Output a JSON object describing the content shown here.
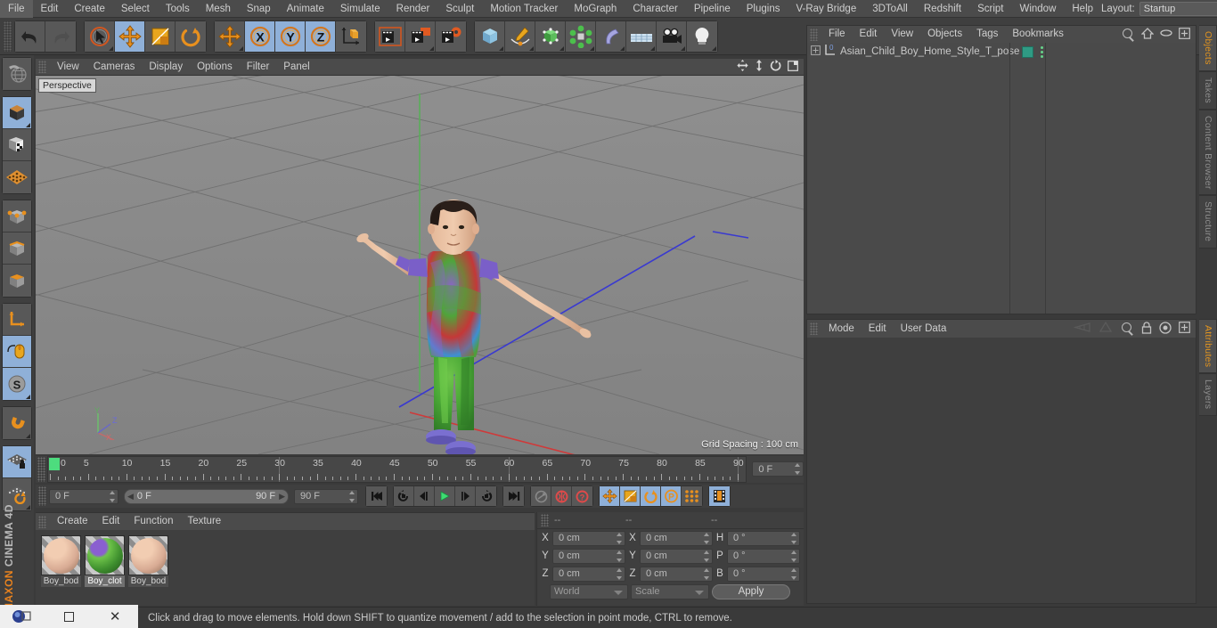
{
  "menubar": {
    "items": [
      "File",
      "Edit",
      "Create",
      "Select",
      "Tools",
      "Mesh",
      "Snap",
      "Animate",
      "Simulate",
      "Render",
      "Sculpt",
      "Motion Tracker",
      "MoGraph",
      "Character",
      "Pipeline",
      "Plugins",
      "V-Ray Bridge",
      "3DToAll",
      "Redshift",
      "Script",
      "Window",
      "Help"
    ],
    "layout_label": "Layout:",
    "layout_value": "Startup",
    "search_icon": "search-icon"
  },
  "toolbar": {
    "groups": [
      {
        "name": "undo-redo",
        "buttons": [
          {
            "icon": "undo-icon",
            "label": "Undo",
            "selected": false
          },
          {
            "icon": "redo-icon",
            "label": "Redo",
            "selected": false
          }
        ]
      },
      {
        "name": "transform-tools",
        "buttons": [
          {
            "icon": "live-selection-icon",
            "label": "Live Selection",
            "selected": false
          },
          {
            "icon": "move-icon",
            "label": "Move",
            "selected": true
          },
          {
            "icon": "scale-icon",
            "label": "Scale",
            "selected": false
          },
          {
            "icon": "rotate-icon",
            "label": "Rotate",
            "selected": false
          }
        ]
      },
      {
        "name": "axis-lock",
        "buttons": [
          {
            "icon": "move-icon",
            "label": "Move",
            "selected": false
          },
          {
            "icon": "x-axis-icon",
            "label": "X Axis",
            "selected": true
          },
          {
            "icon": "y-axis-icon",
            "label": "Y Axis",
            "selected": true
          },
          {
            "icon": "z-axis-icon",
            "label": "Z Axis",
            "selected": true
          },
          {
            "icon": "world-coordinates-icon",
            "label": "World/Object Coordinate System",
            "selected": false
          }
        ]
      },
      {
        "name": "render-tools",
        "buttons": [
          {
            "icon": "render-view-icon",
            "label": "Render View",
            "selected": false
          },
          {
            "icon": "render-picture-viewer-icon",
            "label": "Render to Picture Viewer",
            "selected": false
          },
          {
            "icon": "render-settings-icon",
            "label": "Edit Render Settings",
            "selected": false
          }
        ]
      },
      {
        "name": "object-creation",
        "buttons": [
          {
            "icon": "cube-primitive-icon",
            "label": "Add Cube Object",
            "selected": false
          },
          {
            "icon": "spline-pen-icon",
            "label": "Add Spline Object",
            "selected": false
          },
          {
            "icon": "nurbs-icon",
            "label": "Add Generator Object",
            "selected": false
          },
          {
            "icon": "array-icon",
            "label": "Add Modeling Object",
            "selected": false
          },
          {
            "icon": "bend-deformer-icon",
            "label": "Add Deformation Object",
            "selected": false
          },
          {
            "icon": "floor-icon",
            "label": "Add Environment Object",
            "selected": false
          },
          {
            "icon": "camera-icon",
            "label": "Add Camera Object",
            "selected": false
          },
          {
            "icon": "light-icon",
            "label": "Add Light Object",
            "selected": false
          }
        ]
      }
    ]
  },
  "leftbar": {
    "groups": [
      {
        "buttons": [
          {
            "icon": "undo-view-icon",
            "label": "Undo View",
            "selected": false
          }
        ]
      },
      {
        "buttons": [
          {
            "icon": "object-mode-icon",
            "label": "Model Mode",
            "selected": true
          },
          {
            "icon": "texture-mode-icon",
            "label": "Texture Mode",
            "selected": false
          },
          {
            "icon": "workplane-mode-icon",
            "label": "Workplane Mode",
            "selected": false
          }
        ]
      },
      {
        "buttons": [
          {
            "icon": "points-mode-icon",
            "label": "Points Mode",
            "selected": false
          },
          {
            "icon": "edges-mode-icon",
            "label": "Edges Mode",
            "selected": false
          },
          {
            "icon": "polygons-mode-icon",
            "label": "Polygons Mode",
            "selected": false
          }
        ]
      },
      {
        "buttons": [
          {
            "icon": "axis-mode-icon",
            "label": "Enable Axis Modification",
            "selected": false
          },
          {
            "icon": "viewport-solo-icon",
            "label": "Viewport Solo",
            "selected": true
          },
          {
            "icon": "soft-selection-icon",
            "label": "Soft Selection",
            "selected": true
          }
        ]
      },
      {
        "buttons": [
          {
            "icon": "snap-magnet-icon",
            "label": "Enable Snapping",
            "selected": false
          }
        ]
      },
      {
        "buttons": [
          {
            "icon": "workplane-lock-icon",
            "label": "Lock Workplane",
            "selected": true
          },
          {
            "icon": "planar-workplane-icon",
            "label": "Planar Workplane",
            "selected": false
          }
        ]
      }
    ],
    "brand_maxon": "MAXON",
    "brand_app": "CINEMA 4D"
  },
  "viewport": {
    "menu": [
      "View",
      "Cameras",
      "Display",
      "Options",
      "Filter",
      "Panel"
    ],
    "icons": [
      "move-camera-icon",
      "dolly-camera-icon",
      "rotate-camera-icon",
      "maximize-viewport-icon"
    ],
    "perspective_label": "Perspective",
    "grid_spacing": "Grid Spacing : 100 cm",
    "axis_labels": {
      "y": "Y",
      "z": "Z",
      "x": "X"
    }
  },
  "timeline": {
    "ticks": [
      {
        "value": "0",
        "pos": 0
      },
      {
        "value": "5",
        "pos": 5
      },
      {
        "value": "10",
        "pos": 10
      },
      {
        "value": "15",
        "pos": 15
      },
      {
        "value": "20",
        "pos": 20
      },
      {
        "value": "25",
        "pos": 25
      },
      {
        "value": "30",
        "pos": 30
      },
      {
        "value": "35",
        "pos": 35
      },
      {
        "value": "40",
        "pos": 40
      },
      {
        "value": "45",
        "pos": 45
      },
      {
        "value": "50",
        "pos": 50
      },
      {
        "value": "55",
        "pos": 55
      },
      {
        "value": "60",
        "pos": 60
      },
      {
        "value": "65",
        "pos": 65
      },
      {
        "value": "70",
        "pos": 70
      },
      {
        "value": "75",
        "pos": 75
      },
      {
        "value": "80",
        "pos": 80
      },
      {
        "value": "85",
        "pos": 85
      },
      {
        "value": "90",
        "pos": 90
      }
    ],
    "range_min": 0,
    "range_max": 90,
    "current_frame_field": "0 F"
  },
  "playbar": {
    "start_field": "0 F",
    "range_start": "0 F",
    "range_end": "90 F",
    "end_field": "90 F",
    "buttons": [
      {
        "icon": "go-to-start-icon",
        "label": "Go to Start",
        "selected": false
      },
      {
        "icon": "previous-keyframe-icon",
        "label": "Go to Previous Key",
        "selected": false
      },
      {
        "icon": "previous-frame-icon",
        "label": "Go to Previous Frame",
        "selected": false
      },
      {
        "icon": "play-forwards-icon",
        "label": "Play Forwards",
        "selected": false
      },
      {
        "icon": "next-frame-icon",
        "label": "Go to Next Frame",
        "selected": false
      },
      {
        "icon": "next-keyframe-icon",
        "label": "Go to Next Key",
        "selected": false
      },
      {
        "icon": "go-to-end-icon",
        "label": "Go to End",
        "selected": false
      },
      {
        "icon": "record-active-objects-icon",
        "label": "Record Active Objects",
        "selected": false
      },
      {
        "icon": "autokeying-icon",
        "label": "Autokeying",
        "selected": false
      },
      {
        "icon": "keyframe-selection-icon",
        "label": "Keyframe Selection",
        "selected": false
      },
      {
        "icon": "position-key-icon",
        "label": "Position",
        "selected": true
      },
      {
        "icon": "scale-key-icon",
        "label": "Scale",
        "selected": true
      },
      {
        "icon": "rotation-key-icon",
        "label": "Rotation",
        "selected": true
      },
      {
        "icon": "parameter-key-icon",
        "label": "Parameter",
        "selected": true
      },
      {
        "icon": "point-level-animation-icon",
        "label": "Point Level Animation",
        "selected": false
      },
      {
        "icon": "timeline-icon",
        "label": "Timeline",
        "selected": true
      }
    ]
  },
  "material_manager": {
    "menu": [
      "Create",
      "Edit",
      "Function",
      "Texture"
    ],
    "materials": [
      {
        "name": "Boy_bod",
        "color": "#d8ab94",
        "selected": false
      },
      {
        "name": "Boy_clot",
        "color": "#4aa83c",
        "selected": true
      },
      {
        "name": "Boy_bod",
        "color": "#d8ab94",
        "selected": false
      }
    ]
  },
  "coordinates": {
    "headers": [
      "--",
      "--",
      "--"
    ],
    "rows": [
      {
        "label1": "X",
        "value1": "0 cm",
        "label2": "X",
        "value2": "0 cm",
        "label3": "H",
        "value3": "0 °"
      },
      {
        "label1": "Y",
        "value1": "0 cm",
        "label2": "Y",
        "value2": "0 cm",
        "label3": "P",
        "value3": "0 °"
      },
      {
        "label1": "Z",
        "value1": "0 cm",
        "label2": "Z",
        "value2": "0 cm",
        "label3": "B",
        "value3": "0 °"
      }
    ],
    "system": "World",
    "mode": "Scale",
    "apply": "Apply"
  },
  "object_manager": {
    "menu": [
      "File",
      "Edit",
      "View",
      "Objects",
      "Tags",
      "Bookmarks"
    ],
    "icons": [
      "search-icon",
      "home-icon",
      "ellipse-icon",
      "plus-box-icon"
    ],
    "objects": [
      {
        "name": "Asian_Child_Boy_Home_Style_T_pose",
        "icon": "null-object-icon",
        "layer": "0",
        "tag": "material-tag"
      }
    ]
  },
  "attribute_manager": {
    "menu": [
      "Mode",
      "Edit",
      "User Data"
    ],
    "icons": [
      "prev-history-icon",
      "next-history-icon",
      "search-icon",
      "lock-icon",
      "target-icon",
      "plus-box-icon"
    ]
  },
  "right_tabs": {
    "top": [
      {
        "label": "Objects",
        "active": true
      },
      {
        "label": "Takes",
        "active": false
      },
      {
        "label": "Content Browser",
        "active": false
      },
      {
        "label": "Structure",
        "active": false
      }
    ],
    "bottom": [
      {
        "label": "Attributes",
        "active": true
      },
      {
        "label": "Layers",
        "active": false
      }
    ]
  },
  "statusbar": {
    "text": "Click and drag to move elements. Hold down SHIFT to quantize movement / add to the selection in point mode, CTRL to remove."
  },
  "taskbar": {
    "items": [
      {
        "icon": "c4d-app-icon",
        "label": "Cinema 4D"
      },
      {
        "icon": "restore-window-icon",
        "label": "Restore"
      },
      {
        "icon": "close-window-icon",
        "label": "Close"
      }
    ]
  },
  "colors": {
    "accent_orange": "#e8821e",
    "selection_blue": "#8fb0d8",
    "panel_bg": "#3f3f3f",
    "menu_bg": "#4b4b4b",
    "green_marker": "#4ddc7e",
    "tag_teal": "#2f9b84"
  }
}
